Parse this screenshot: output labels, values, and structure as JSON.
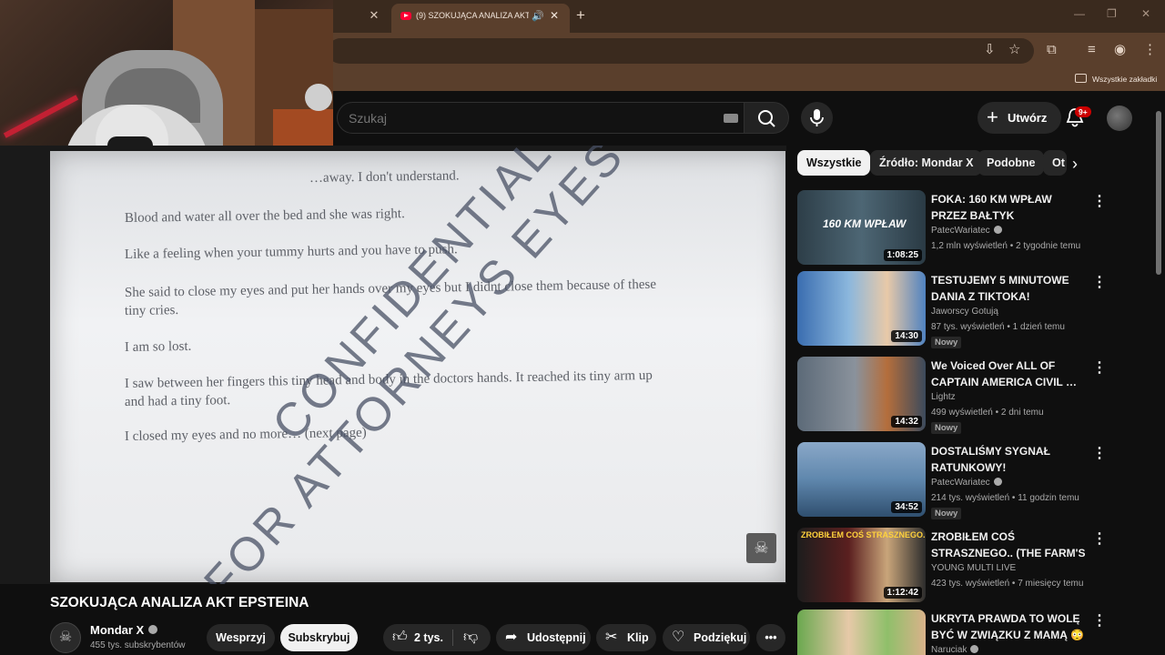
{
  "browser": {
    "active_tab_title": "(9) SZOKUJĄCA ANALIZA AKT EPSTEINA",
    "bookmarks_label": "Wszystkie zakładki"
  },
  "masthead": {
    "search_placeholder": "Szukaj",
    "create_label": "Utwórz",
    "notification_count": "9+"
  },
  "video_frame": {
    "lines": [
      "…away. I don't understand.",
      "Blood and water all over the bed and she was right.",
      "Like a feeling when your tummy hurts and you have to push.",
      "She said to close my eyes and put her hands over my eyes but I didnt close them because of these",
      "tiny cries.",
      "I am so lost.",
      "I saw between her fingers this tiny head and body in the doctors hands. It reached its tiny arm up",
      "and had a tiny foot.",
      "I closed my eyes and no more… (next page)"
    ],
    "watermark_1": "CONFIDENTIAL",
    "watermark_2": "FOR ATTORNEYS EYES ONLY"
  },
  "video": {
    "title": "SZOKUJĄCA ANALIZA AKT EPSTEINA",
    "channel_name": "Mondar X",
    "subscribers": "455 tys. subskrybentów",
    "support_label": "Wesprzyj",
    "subscribe_label": "Subskrybuj",
    "likes": "2 tys.",
    "share_label": "Udostępnij",
    "clip_label": "Klip",
    "thanks_label": "Podziękuj"
  },
  "chips": [
    "Wszystkie",
    "Źródło: Mondar X",
    "Podobne",
    "Ot"
  ],
  "related": [
    {
      "title": "FOKA: 160 KM WPŁAW PRZEZ BAŁTYK",
      "channel": "PatecWariatec",
      "verified": true,
      "meta": "1,2 mln wyświetleń • 2 tygodnie temu",
      "duration": "1:08:25",
      "badge": "",
      "thumb_text": "160 KM WPŁAW"
    },
    {
      "title": "TESTUJEMY 5 MINUTOWE DANIA Z TIKTOKA!",
      "channel": "Jaworscy Gotują",
      "verified": false,
      "meta": "87 tys. wyświetleń • 1 dzień temu",
      "duration": "14:30",
      "badge": "Nowy",
      "thumb_text": ""
    },
    {
      "title": "We Voiced Over ALL OF CAPTAIN AMERICA CIVIL …",
      "channel": "Lightz",
      "verified": false,
      "meta": "499 wyświetleń • 2 dni temu",
      "duration": "14:32",
      "badge": "Nowy",
      "thumb_text": ""
    },
    {
      "title": "DOSTALIŚMY SYGNAŁ RATUNKOWY!",
      "channel": "PatecWariatec",
      "verified": true,
      "meta": "214 tys. wyświetleń • 11 godzin temu",
      "duration": "34:52",
      "badge": "Nowy",
      "thumb_text": ""
    },
    {
      "title": "ZROBIŁEM COŚ STRASZNEGO.. (THE FARM'S SECRET)",
      "channel": "YOUNG MULTI LIVE",
      "verified": false,
      "meta": "423 tys. wyświetleń • 7 miesięcy temu",
      "duration": "1:12:42",
      "badge": "",
      "thumb_text": "ZROBIŁEM COŚ STRASZNEGO.."
    },
    {
      "title": "UKRYTA PRAWDA TO WOLĘ BYĆ W ZWIĄZKU Z MAMĄ 😳",
      "channel": "Naruciak",
      "verified": true,
      "meta": "",
      "duration": "",
      "badge": "",
      "thumb_text": ""
    }
  ]
}
